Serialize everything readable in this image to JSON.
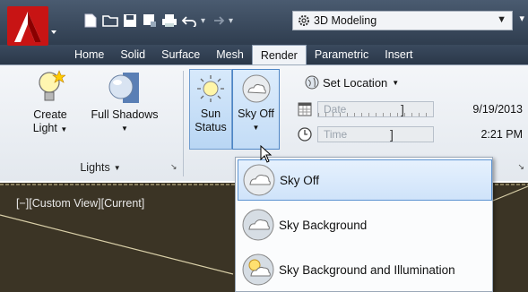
{
  "quick_access": {
    "workspace": "3D Modeling"
  },
  "tabs": [
    {
      "label": "Home"
    },
    {
      "label": "Solid"
    },
    {
      "label": "Surface"
    },
    {
      "label": "Mesh"
    },
    {
      "label": "Render",
      "active": true
    },
    {
      "label": "Parametric"
    },
    {
      "label": "Insert"
    }
  ],
  "lights_panel": {
    "create_light": {
      "line1": "Create",
      "line2": "Light"
    },
    "full_shadows": "Full Shadows",
    "title": "Lights"
  },
  "sun_panel": {
    "sun_status": {
      "line1": "Sun",
      "line2": "Status"
    },
    "sky_off": "Sky Off",
    "set_location": "Set Location",
    "date_label": "Date",
    "date_value": "9/19/2013",
    "time_label": "Time",
    "time_value": "2:21 PM"
  },
  "viewport": {
    "label": "[−][Custom View][Current]"
  },
  "sky_dropdown": {
    "items": [
      {
        "label": "Sky Off",
        "selected": true
      },
      {
        "label": "Sky Background"
      },
      {
        "label": "Sky Background and Illumination"
      }
    ]
  },
  "colors": {
    "title_bar": "#3a4a5e",
    "highlight": "#cfe3fa",
    "viewport_bg": "#3b3425"
  }
}
